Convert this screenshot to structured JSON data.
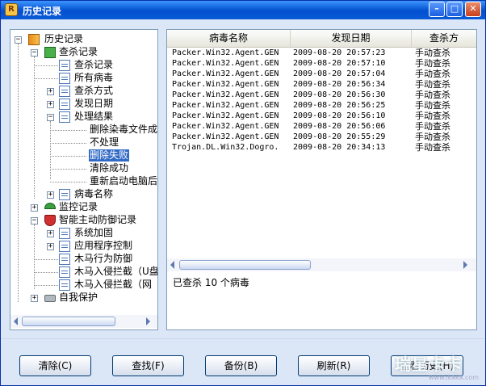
{
  "window": {
    "title": "历史记录",
    "minimize": "–",
    "maximize": "□",
    "close": "✕"
  },
  "tree": {
    "root": "历史记录",
    "kill_records": "查杀记录",
    "kill_records_child": "查杀记录",
    "all_viruses": "所有病毒",
    "scan_method": "查杀方式",
    "found_date": "发现日期",
    "process_result": "处理结果",
    "result_delete_infected": "删除染毒文件成",
    "result_no_action": "不处理",
    "result_delete_failed": "删除失败",
    "result_clear_success": "清除成功",
    "result_reboot": "重新启动电脑后",
    "virus_name": "病毒名称",
    "monitor_records": "监控记录",
    "active_defense": "智能主动防御记录",
    "system_hardening": "系统加固",
    "app_control": "应用程序控制",
    "trojan_defense": "木马行为防御",
    "trojan_block_usb": "木马入侵拦截（U盘",
    "trojan_block_web": "木马入侵拦截（网",
    "self_protect": "自我保护"
  },
  "table": {
    "columns": [
      "病毒名称",
      "发现日期",
      "查杀方"
    ],
    "rows": [
      [
        "Packer.Win32.Agent.GEN",
        "2009-08-20 20:57:23",
        "手动查杀"
      ],
      [
        "Packer.Win32.Agent.GEN",
        "2009-08-20 20:57:10",
        "手动查杀"
      ],
      [
        "Packer.Win32.Agent.GEN",
        "2009-08-20 20:57:04",
        "手动查杀"
      ],
      [
        "Packer.Win32.Agent.GEN",
        "2009-08-20 20:56:34",
        "手动查杀"
      ],
      [
        "Packer.Win32.Agent.GEN",
        "2009-08-20 20:56:30",
        "手动查杀"
      ],
      [
        "Packer.Win32.Agent.GEN",
        "2009-08-20 20:56:25",
        "手动查杀"
      ],
      [
        "Packer.Win32.Agent.GEN",
        "2009-08-20 20:56:10",
        "手动查杀"
      ],
      [
        "Packer.Win32.Agent.GEN",
        "2009-08-20 20:56:06",
        "手动查杀"
      ],
      [
        "Packer.Win32.Agent.GEN",
        "2009-08-20 20:55:29",
        "手动查杀"
      ],
      [
        "Trojan.DL.Win32.Dogro.",
        "2009-08-20 20:34:13",
        "手动查杀"
      ]
    ],
    "status": "已查杀 10 个病毒"
  },
  "buttons": {
    "clear": "清除(C)",
    "find": "查找(F)",
    "backup": "备份(B)",
    "refresh": "刷新(R)",
    "view_history": "查看历史(H)"
  },
  "watermark": {
    "text": "瑞星卡卡",
    "sub": "www.ikaka.com"
  },
  "colors": {
    "titlebar": "#0a5bd6",
    "selection": "#316ac5",
    "window_bg": "#dbe6f7"
  }
}
